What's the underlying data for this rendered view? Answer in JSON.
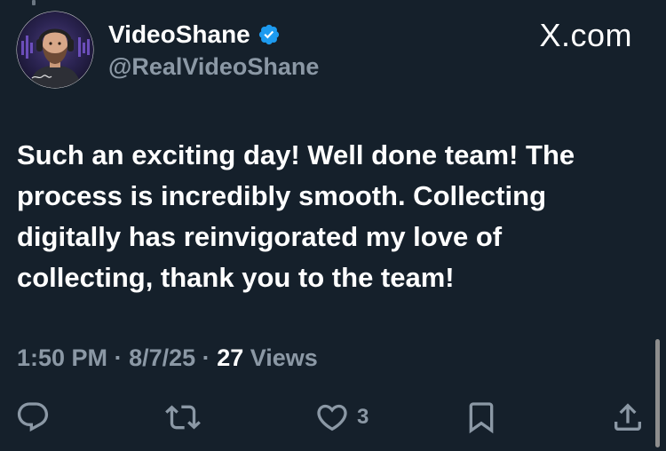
{
  "post": {
    "author": {
      "display_name": "VideoShane",
      "handle": "@RealVideoShane",
      "verified": true,
      "avatar_icon": "avatar-bearded-man-headphones"
    },
    "source_label": "X.com",
    "text": "Such an exciting day! Well done team! The process is incredibly smooth. Collecting digitally has reinvigorated my love of collecting, thank you to the team!",
    "meta": {
      "time": "1:50 PM",
      "separator": "·",
      "date": "8/7/25",
      "views_count": "27",
      "views_label": "Views"
    },
    "actions": {
      "reply": {
        "icon": "reply-icon"
      },
      "repost": {
        "icon": "repost-icon"
      },
      "like": {
        "icon": "heart-icon",
        "count": "3"
      },
      "bookmark": {
        "icon": "bookmark-icon"
      },
      "share": {
        "icon": "share-icon"
      }
    }
  },
  "colors": {
    "background": "#15202b",
    "primary_text": "#ffffff",
    "secondary_text": "#8b98a5",
    "verified_badge": "#1d9bf0"
  }
}
